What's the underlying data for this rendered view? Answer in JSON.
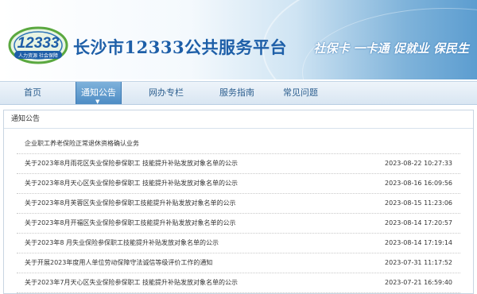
{
  "header": {
    "logo_number": "12333",
    "logo_tagline": "人力资源 社会保障",
    "site_title": "长沙市12333公共服务平台",
    "slogan": "社保卡 一卡通 促就业 保民生"
  },
  "nav": {
    "items": [
      {
        "label": "首页",
        "active": false
      },
      {
        "label": "通知公告",
        "active": true
      },
      {
        "label": "网办专栏",
        "active": false
      },
      {
        "label": "服务指南",
        "active": false
      },
      {
        "label": "常见问题",
        "active": false
      }
    ]
  },
  "notices": {
    "title": "通知公告",
    "items": [
      {
        "title": "企业职工养老保险正常退休资格确认业务",
        "date": ""
      },
      {
        "title": "关于2023年8月雨花区失业保险参保职工 技能提升补贴发放对象名单的公示",
        "date": "2023-08-22 10:27:33"
      },
      {
        "title": "关于2023年8月天心区失业保险参保职工 技能提升补贴发放对象名单的公示",
        "date": "2023-08-16 16:09:56"
      },
      {
        "title": "关于2023年8月芙蓉区失业保险参保职工技能提升补贴发放对象名单的公示",
        "date": "2023-08-15 11:23:06"
      },
      {
        "title": "关于2023年8月开福区失业保险参保职工技能提升补贴发放对象名单的公示",
        "date": "2023-08-14 17:20:57"
      },
      {
        "title": "关于2023年8 月失业保险参保职工技能提升补贴发放对象名单的公示",
        "date": "2023-08-14 17:19:14"
      },
      {
        "title": "关于开展2023年度用人单位劳动保障守法诚信等级评价工作的通知",
        "date": "2023-07-31 11:17:52"
      },
      {
        "title": "关于2023年7月天心区失业保险参保职工 技能提升补贴发放对象名单的公示",
        "date": "2023-07-21 16:59:40"
      }
    ]
  }
}
